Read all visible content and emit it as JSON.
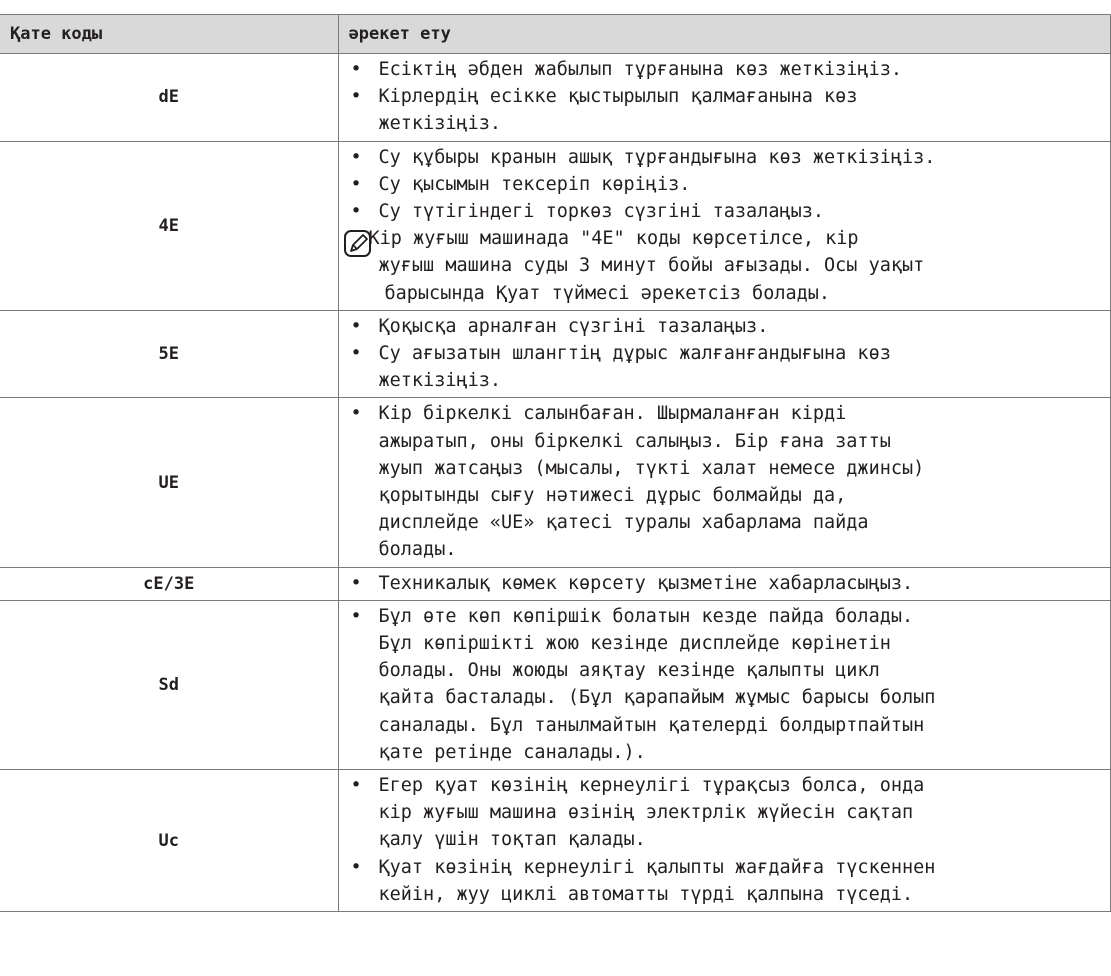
{
  "header": {
    "col_code": "Қате коды",
    "col_action": "әрекет ету"
  },
  "rows": [
    {
      "code": "dE",
      "items": [
        [
          "Есіктің әбден жабылып тұрғанына көз жеткізіңіз."
        ],
        [
          "Кірлердің есікке қыстырылып қалмағанына көз",
          "жеткізіңіз."
        ]
      ]
    },
    {
      "code": "4E",
      "items": [
        [
          "Су құбыры кранын ашық тұрғандығына көз жеткізіңіз."
        ],
        [
          "Су қысымын тексеріп көріңіз."
        ],
        [
          "Су түтігіндегі торкөз сүзгіні тазалаңыз."
        ]
      ],
      "note": [
        "Кір жуғыш машинада \"4E\" коды көрсетілсе, кір",
        "жуғыш машина суды 3 минут бойы ағызады. Осы уақыт",
        "барысында  Қуат түймесі әрекетсіз болады."
      ]
    },
    {
      "code": "5E",
      "items": [
        [
          "Қоқысқа арналған сүзгіні тазалаңыз."
        ],
        [
          "Су ағызатын шлангтің дұрыс жалғанғандығына көз",
          "жеткізіңіз."
        ]
      ]
    },
    {
      "code": "UE",
      "items": [
        [
          "Кір біркелкі салынбаған. Шырмаланған кірді",
          "ажыратып, оны біркелкі салыңыз. Бір ғана затты",
          "жуып жатсаңыз (мысалы, түкті халат немесе джинсы)",
          "қорытынды сығу нәтижесі дұрыс болмайды да,",
          "дисплейде «UE» қатесі туралы хабарлама  пайда",
          "болады."
        ]
      ]
    },
    {
      "code": "cE/3E",
      "items": [
        [
          "Техникалық көмек көрсету қызметіне хабарласыңыз."
        ]
      ]
    },
    {
      "code": "Sd",
      "items": [
        [
          "Бұл өте көп көпіршік болатын кезде пайда болады.",
          "Бұл көпіршікті жою кезінде дисплейде көрінетін",
          "болады. Оны жоюды аяқтау кезінде қалыпты цикл",
          "қайта басталады. (Бұл қарапайым жұмыс барысы болып",
          "саналады. Бұл танылмайтын қателерді болдыртпайтын",
          "қате ретінде саналады.)."
        ]
      ]
    },
    {
      "code": "Uc",
      "items": [
        [
          "Егер қуат көзінің кернеулігі тұрақсыз болса, онда",
          "кір жуғыш машина өзінің электрлік жүйесін сақтап",
          "қалу үшін тоқтап қалады."
        ],
        [
          "Қуат көзінің кернеулігі қалыпты жағдайға түскеннен",
          "кейін, жуу циклі автоматты түрді қалпына түседі."
        ]
      ]
    }
  ]
}
